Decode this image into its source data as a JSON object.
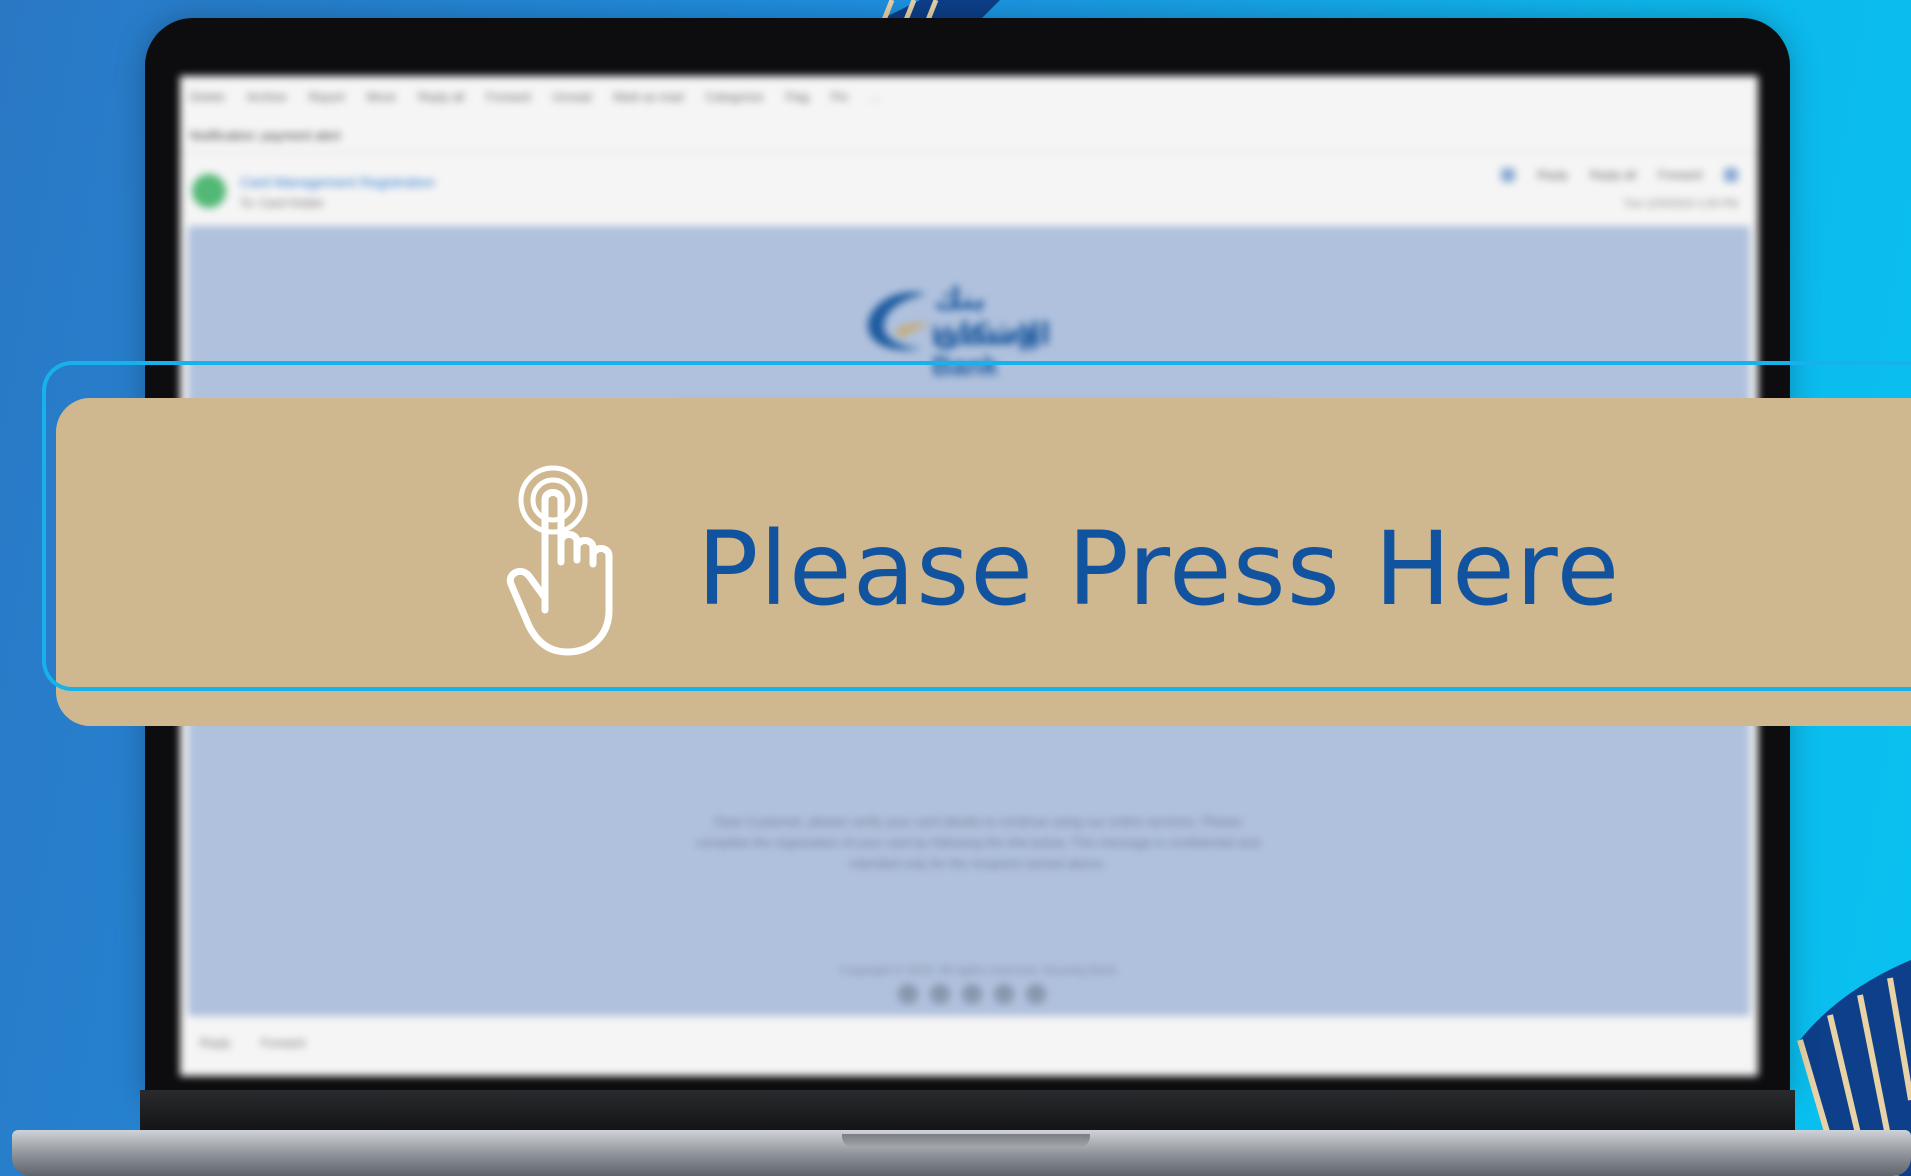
{
  "email": {
    "tabs": [
      "Delete",
      "Archive",
      "Report",
      "Move",
      "Reply all",
      "Forward",
      "Unread",
      "Mark as read",
      "Categorize",
      "Flag",
      "Pin",
      "..."
    ],
    "subject": "Notification: payment alert",
    "sender_name": "Card Management Registration",
    "sender_to": "To: Card Holder",
    "actions": [
      "Reply",
      "Reply all",
      "Forward"
    ],
    "date": "Tue 12/5/2023 1:05 PM",
    "bank_name_ar": "بنك الإسكان",
    "bank_name_en": "Housing Bank",
    "body_paragraph": "Dear Customer, please verify your card details to continue using our online services. Please complete the registration of your card by following the link below. This message is confidential and intended only for the recipient named above.",
    "copyright": "Copyright © 2023. All rights reserved. Housing Bank",
    "footer_actions": [
      "Reply",
      "Forward"
    ]
  },
  "overlay": {
    "label": "Please Press Here",
    "icon": "tap-hand-icon",
    "colors": {
      "banner": "#cfb88f",
      "text": "#1253a0",
      "outline": "#17b2ec"
    }
  }
}
